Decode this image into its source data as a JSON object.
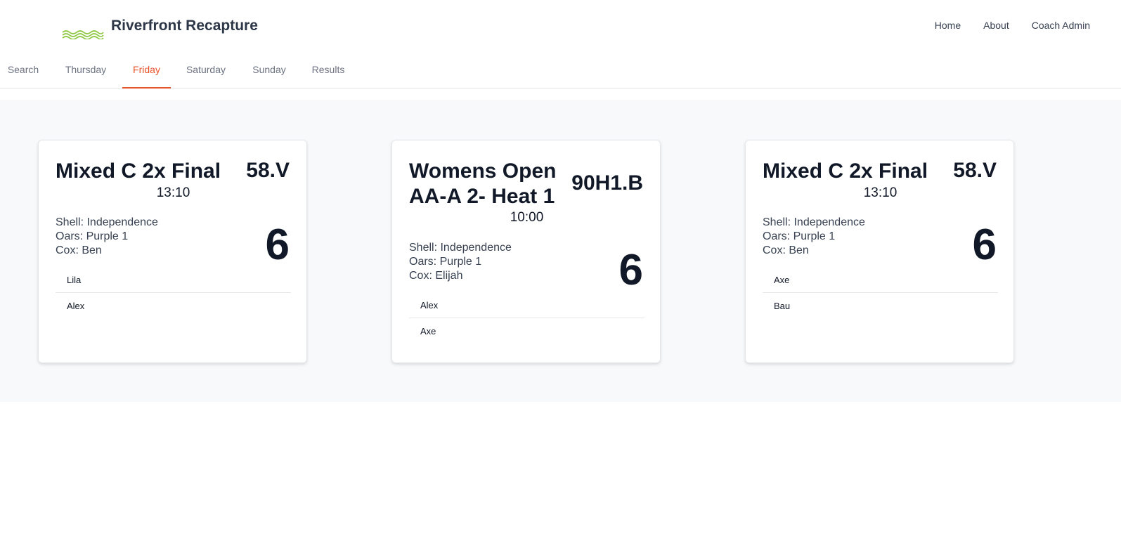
{
  "brand": {
    "name": "Riverfront Recapture",
    "logo_icon": "waves-logo-icon",
    "logo_color": "#8cc63f"
  },
  "topnav": [
    "Home",
    "About",
    "Coach Admin"
  ],
  "tabs": {
    "items": [
      "Search",
      "Thursday",
      "Friday",
      "Saturday",
      "Sunday",
      "Results"
    ],
    "active": "Friday",
    "accent_color": "#e8542a"
  },
  "cards": [
    {
      "title": "Mixed C 2x Final",
      "code": "58.V",
      "time": "13:10",
      "shell": "Shell: Independence",
      "oars": "Oars: Purple 1",
      "cox": "Cox: Ben",
      "lane": "6",
      "rowers": [
        "Lila",
        "Alex"
      ]
    },
    {
      "title": "Womens Open AA-A 2- Heat 1",
      "code": "90H1.B",
      "time": "10:00",
      "shell": "Shell: Independence",
      "oars": "Oars: Purple 1",
      "cox": "Cox: Elijah",
      "lane": "6",
      "rowers": [
        "Alex",
        "Axe"
      ]
    },
    {
      "title": "Mixed C 2x Final",
      "code": "58.V",
      "time": "13:10",
      "shell": "Shell: Independence",
      "oars": "Oars: Purple 1",
      "cox": "Cox: Ben",
      "lane": "6",
      "rowers": [
        "Axe",
        "Bau"
      ]
    }
  ]
}
